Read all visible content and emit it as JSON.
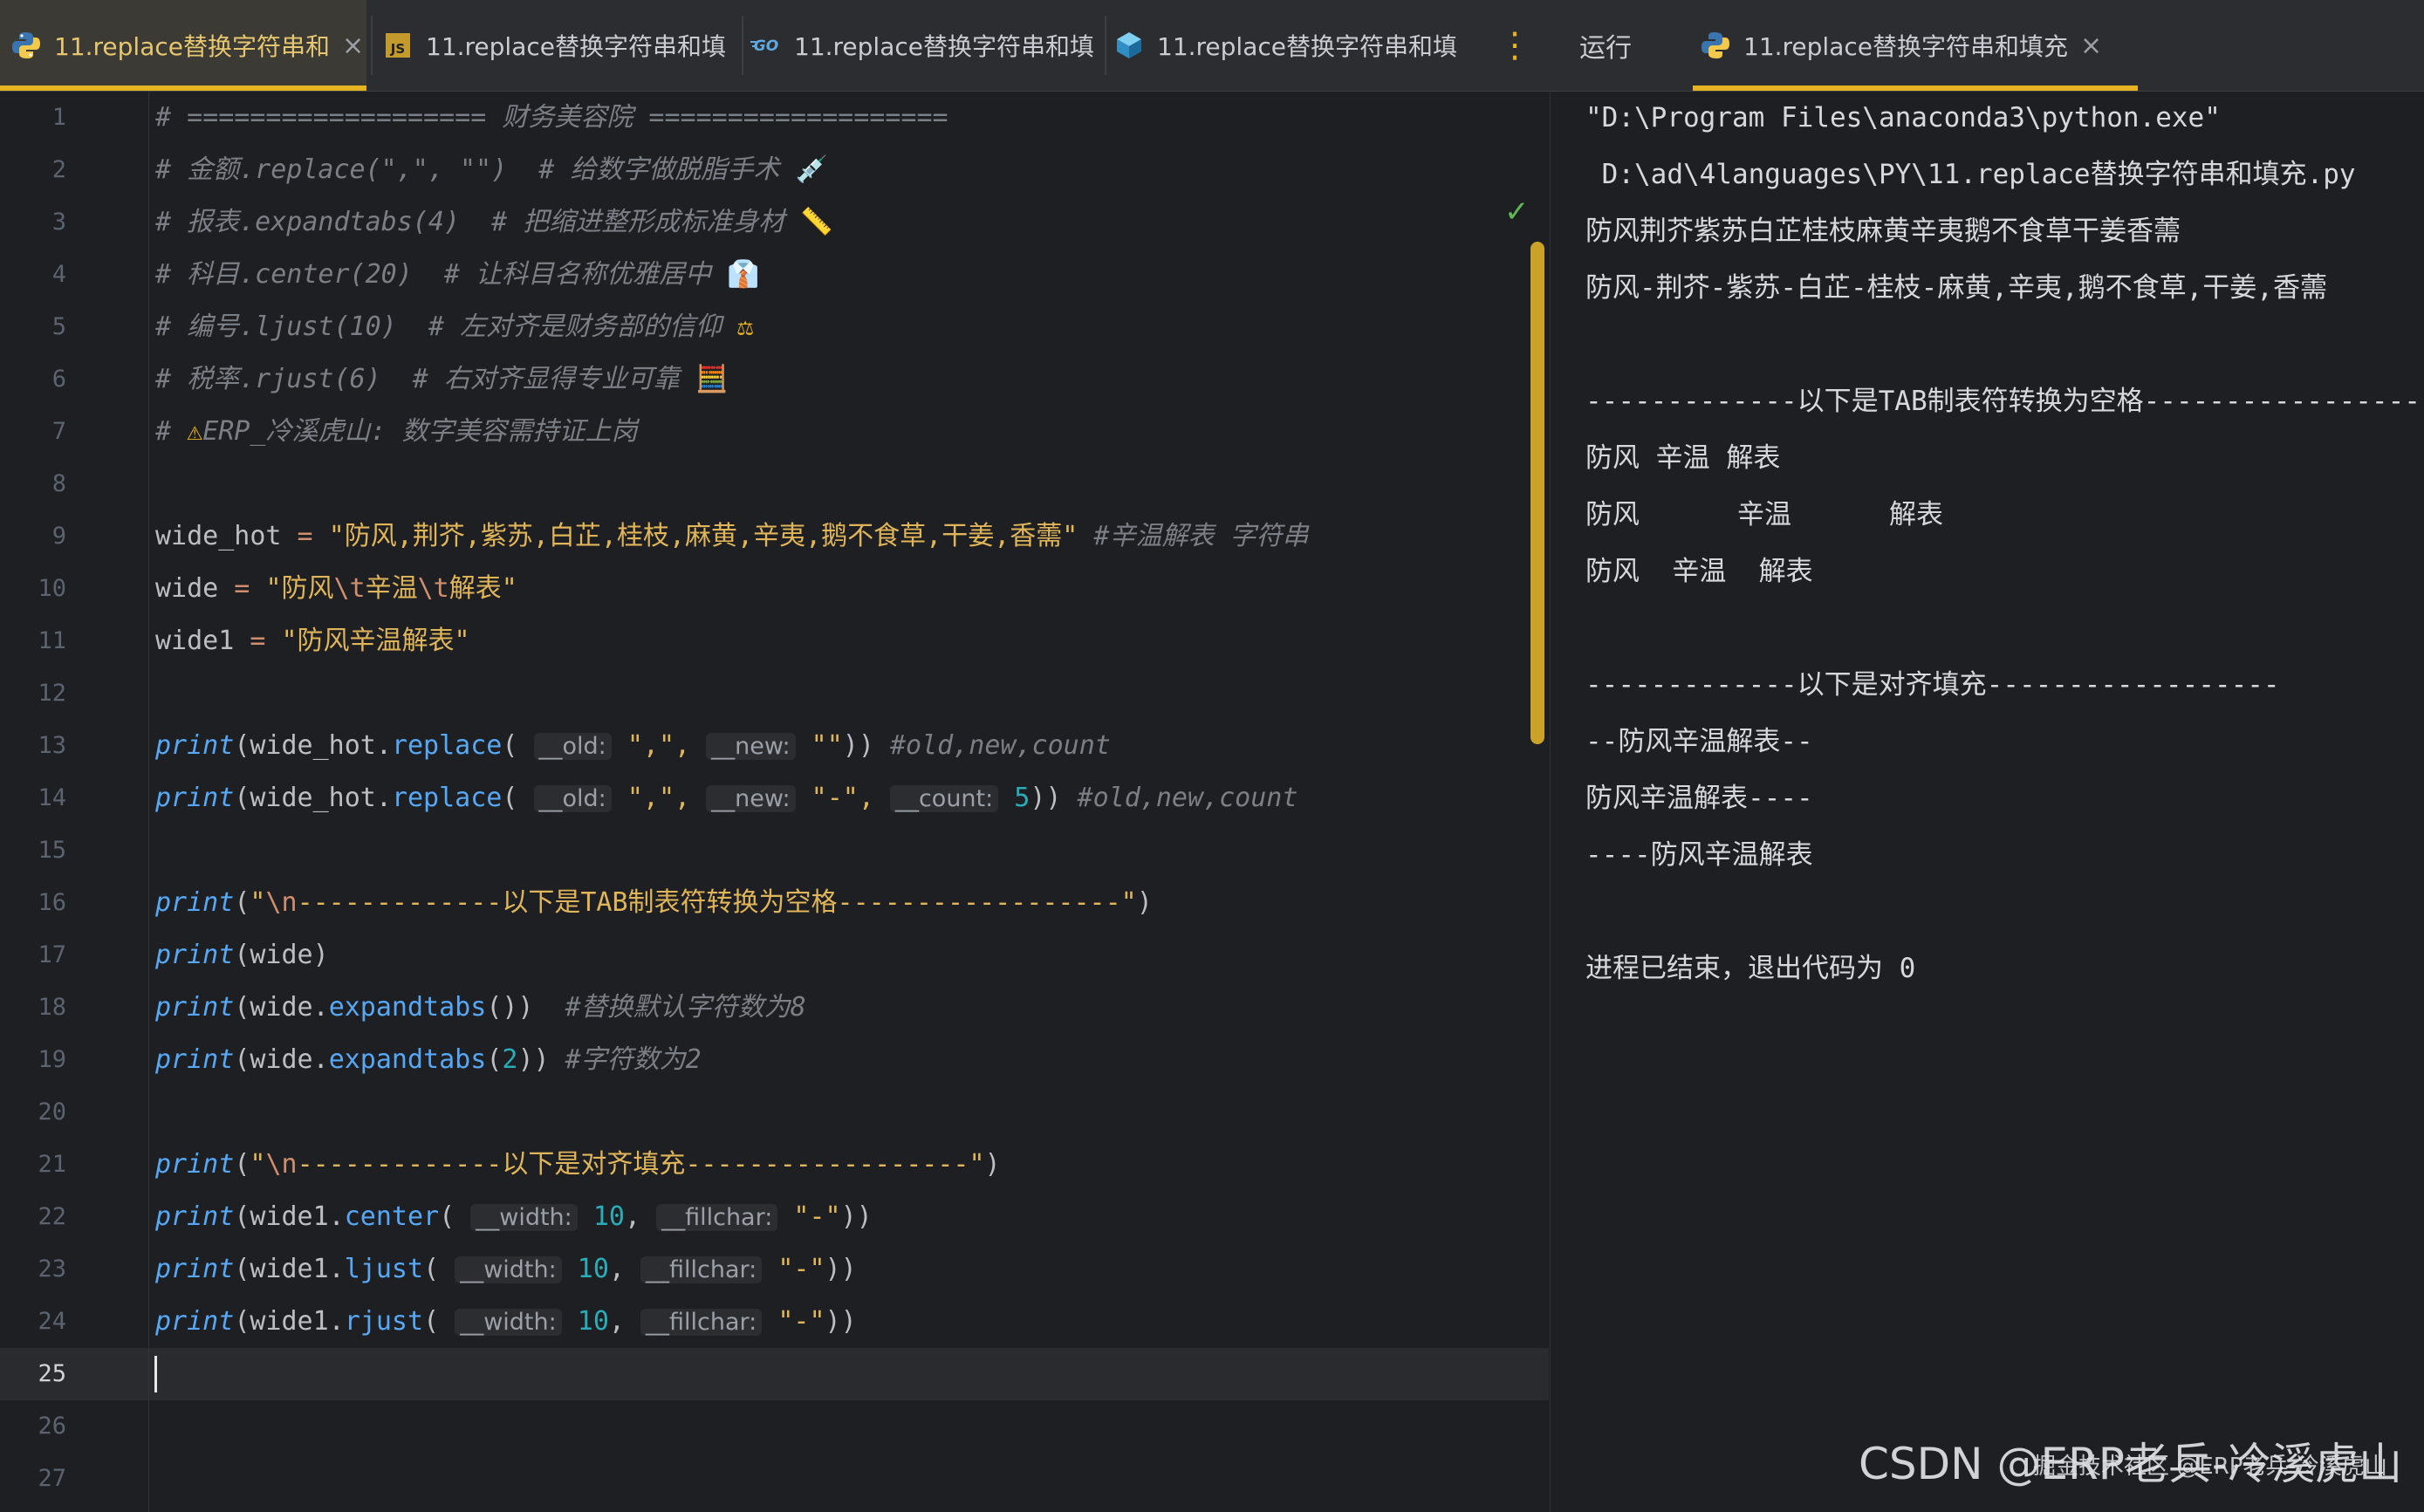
{
  "tabs": [
    {
      "label": "11.replace替换字符串和",
      "icon": "python-icon",
      "close": "×"
    },
    {
      "label": "11.replace替换字符串和填",
      "icon": "javascript-icon"
    },
    {
      "label": "11.replace替换字符串和填",
      "icon": "go-icon"
    },
    {
      "label": "11.replace替换字符串和填",
      "icon": "cube-icon"
    }
  ],
  "run": {
    "label": "运行",
    "tab_label": "11.replace替换字符串和填充",
    "tab_close": "×"
  },
  "editor": {
    "line_numbers": [
      "1",
      "2",
      "3",
      "4",
      "5",
      "6",
      "7",
      "8",
      "9",
      "10",
      "11",
      "12",
      "13",
      "14",
      "15",
      "16",
      "17",
      "18",
      "19",
      "20",
      "21",
      "22",
      "23",
      "24",
      "25",
      "26",
      "27"
    ],
    "current_line": "25",
    "comments": {
      "l1": "# =================== 财务美容院 ===================",
      "l2a": "# 金额.replace(\",\", \"\")  # 给数字做脱脂手术 ",
      "l3a": "# 报表.expandtabs(4)  # 把缩进整形成标准身材 ",
      "l4a": "# 科目.center(20)  # 让科目名称优雅居中 ",
      "l5a": "# 编号.ljust(10)  # 左对齐是财务部的信仰 ",
      "l6a": "# 税率.rjust(6)  # 右对齐显得专业可靠 ",
      "l7a": "# ",
      "l7b": "ERP_冷溪虎山: 数字美容需持证上岗"
    },
    "emoji": {
      "l2": "💉",
      "l3": "📏",
      "l4": "👔",
      "l5": "⚖",
      "l6": "🧮",
      "l7": "⚠"
    },
    "code": {
      "l9_var": "wide_hot",
      "l9_eq": " = ",
      "l9_str": "\"防风,荆芥,紫苏,白芷,桂枝,麻黄,辛夷,鹅不食草,干姜,香薷\"",
      "l9_cmt": " #辛温解表 字符串",
      "l10_var": "wide",
      "l10_eq": " = ",
      "l10_s1": "\"防风",
      "l10_e1": "\\t",
      "l10_s2": "辛温",
      "l10_e2": "\\t",
      "l10_s3": "解表\"",
      "l11_var": "wide1",
      "l11_eq": " = ",
      "l11_str": "\"防风辛温解表\"",
      "print": "print",
      "l13_a": "(wide_hot.",
      "l13_fn": "replace",
      "l13_b": "( ",
      "hint_old": "__old:",
      "hint_new": "__new:",
      "hint_count": "__count:",
      "hint_width": "__width:",
      "hint_fillchar": "__fillchar:",
      "l13_s1": " \",\", ",
      "l13_s2": " \"\"",
      "l13_c": "))",
      "l13_cmt": " #old,new,count",
      "l14_s2": " \"-\", ",
      "l14_num": " 5",
      "l14_c": "))",
      "l14_cmt": " #old,new,count",
      "l16_a": "(",
      "l16_s1": "\"",
      "l16_esc": "\\n",
      "l16_s2": "-------------以下是TAB制表符转换为空格------------------\"",
      "l16_c": ")",
      "l17": "(wide)",
      "l18_a": "(wide.",
      "l18_fn": "expandtabs",
      "l18_b": "())",
      "l18_cmt": "  #替换默认字符数为8",
      "l19_a": "(wide.",
      "l19_fn": "expandtabs",
      "l19_b": "(",
      "l19_num": "2",
      "l19_c": "))",
      "l19_cmt": " #字符数为2",
      "l21_s2": "-------------以下是对齐填充------------------\"",
      "l22_a": "(wide1.",
      "l22_fn": "center",
      "l23_fn": "ljust",
      "l24_fn": "rjust",
      "paren_open": "( ",
      "num10": " 10",
      "comma": ", ",
      "dash_str": " \"-\"",
      "close2": "))"
    }
  },
  "output": {
    "lines": [
      "\"D:\\Program Files\\anaconda3\\python.exe\"",
      " D:\\ad\\4languages\\PY\\11.replace替换字符串和填充.py",
      "防风荆芥紫苏白芷桂枝麻黄辛夷鹅不食草干姜香薷",
      "防风-荆芥-紫苏-白芷-桂枝-麻黄,辛夷,鹅不食草,干姜,香薷",
      "",
      "-------------以下是TAB制表符转换为空格------------------",
      "防风 辛温 解表",
      "防风      辛温      解表",
      "防风  辛温  解表",
      "",
      "-------------以下是对齐填充------------------",
      "--防风辛温解表--",
      "防风辛温解表----",
      "----防风辛温解表",
      "",
      "进程已结束，退出代码为 0"
    ]
  },
  "watermark": {
    "text": "CSDN @ERP老兵-冷溪虎山",
    "sub": "掘金技术社区 @ERP老兵-冷溪虎山"
  },
  "colors": {
    "accent": "#e6b422",
    "background": "#1e1f22",
    "comment": "#7a7e85",
    "string": "#6aab73"
  }
}
